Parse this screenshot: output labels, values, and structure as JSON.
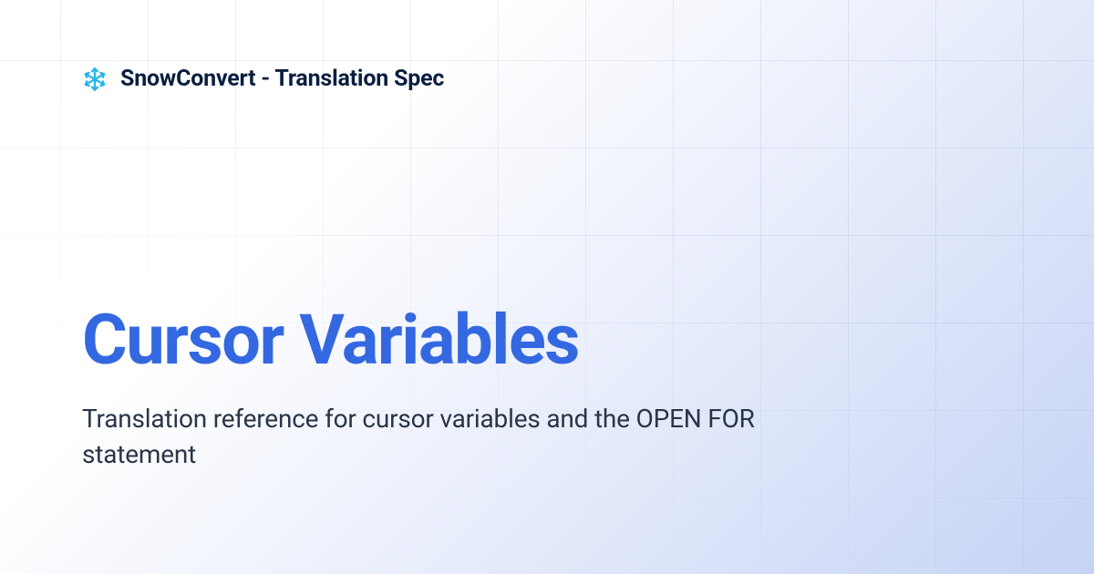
{
  "header": {
    "product_name": "SnowConvert",
    "separator": " - ",
    "section": "Translation Spec"
  },
  "main": {
    "title": "Cursor Variables",
    "description": "Translation reference for cursor variables and the OPEN FOR statement"
  },
  "colors": {
    "accent_blue": "#3468e0",
    "dark_text": "#0a1e3f",
    "body_text": "#2a3548"
  }
}
